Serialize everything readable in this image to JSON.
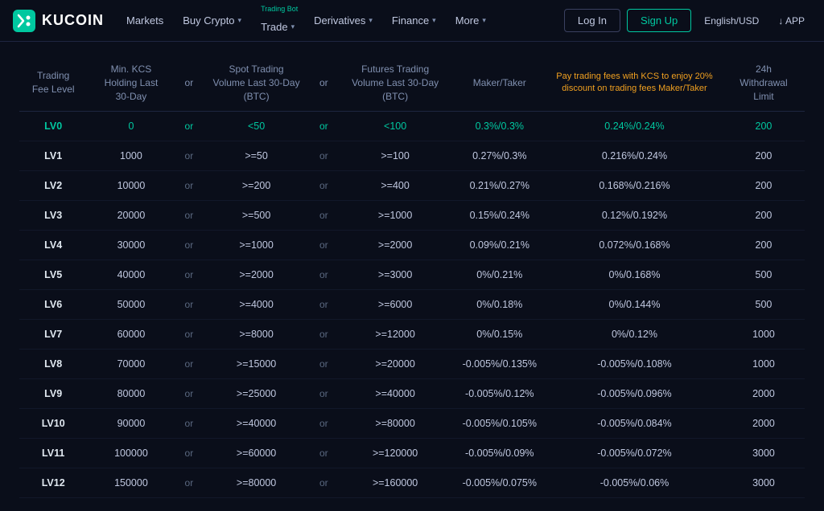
{
  "navbar": {
    "logo_text": "KUCOIN",
    "nav_items": [
      {
        "label": "Markets",
        "has_dropdown": false,
        "sub_label": null
      },
      {
        "label": "Buy Crypto",
        "has_dropdown": true,
        "sub_label": null
      },
      {
        "label": "Trade",
        "has_dropdown": true,
        "sub_label": "Trading Bot"
      },
      {
        "label": "Derivatives",
        "has_dropdown": true,
        "sub_label": null
      },
      {
        "label": "Finance",
        "has_dropdown": true,
        "sub_label": null
      },
      {
        "label": "More",
        "has_dropdown": true,
        "sub_label": null
      }
    ],
    "login_label": "Log In",
    "signup_label": "Sign Up",
    "lang_label": "English/USD",
    "app_label": "↓ APP"
  },
  "table": {
    "headers": [
      {
        "key": "level",
        "label": "Trading Fee Level"
      },
      {
        "key": "kcs",
        "label": "Min. KCS Holding Last 30-Day"
      },
      {
        "key": "or1",
        "label": "or"
      },
      {
        "key": "spot",
        "label": "Spot Trading Volume Last 30-Day (BTC)"
      },
      {
        "key": "or2",
        "label": "or"
      },
      {
        "key": "futures",
        "label": "Futures Trading Volume Last 30-Day (BTC)"
      },
      {
        "key": "maker_taker",
        "label": "Maker/Taker"
      },
      {
        "key": "kcs_discount",
        "label": "Pay trading fees with KCS to enjoy 20% discount on trading fees Maker/Taker",
        "highlight": true
      },
      {
        "key": "withdrawal",
        "label": "24h Withdrawal Limit"
      }
    ],
    "rows": [
      {
        "level": "LV0",
        "kcs": "0",
        "spot": "<50",
        "futures": "<100",
        "maker_taker": "0.3%/0.3%",
        "kcs_discount": "0.24%/0.24%",
        "withdrawal": "200",
        "highlighted": true
      },
      {
        "level": "LV1",
        "kcs": "1000",
        "spot": ">=50",
        "futures": ">=100",
        "maker_taker": "0.27%/0.3%",
        "kcs_discount": "0.216%/0.24%",
        "withdrawal": "200",
        "highlighted": false
      },
      {
        "level": "LV2",
        "kcs": "10000",
        "spot": ">=200",
        "futures": ">=400",
        "maker_taker": "0.21%/0.27%",
        "kcs_discount": "0.168%/0.216%",
        "withdrawal": "200",
        "highlighted": false
      },
      {
        "level": "LV3",
        "kcs": "20000",
        "spot": ">=500",
        "futures": ">=1000",
        "maker_taker": "0.15%/0.24%",
        "kcs_discount": "0.12%/0.192%",
        "withdrawal": "200",
        "highlighted": false
      },
      {
        "level": "LV4",
        "kcs": "30000",
        "spot": ">=1000",
        "futures": ">=2000",
        "maker_taker": "0.09%/0.21%",
        "kcs_discount": "0.072%/0.168%",
        "withdrawal": "200",
        "highlighted": false
      },
      {
        "level": "LV5",
        "kcs": "40000",
        "spot": ">=2000",
        "futures": ">=3000",
        "maker_taker": "0%/0.21%",
        "kcs_discount": "0%/0.168%",
        "withdrawal": "500",
        "highlighted": false
      },
      {
        "level": "LV6",
        "kcs": "50000",
        "spot": ">=4000",
        "futures": ">=6000",
        "maker_taker": "0%/0.18%",
        "kcs_discount": "0%/0.144%",
        "withdrawal": "500",
        "highlighted": false
      },
      {
        "level": "LV7",
        "kcs": "60000",
        "spot": ">=8000",
        "futures": ">=12000",
        "maker_taker": "0%/0.15%",
        "kcs_discount": "0%/0.12%",
        "withdrawal": "1000",
        "highlighted": false
      },
      {
        "level": "LV8",
        "kcs": "70000",
        "spot": ">=15000",
        "futures": ">=20000",
        "maker_taker": "-0.005%/0.135%",
        "kcs_discount": "-0.005%/0.108%",
        "withdrawal": "1000",
        "highlighted": false
      },
      {
        "level": "LV9",
        "kcs": "80000",
        "spot": ">=25000",
        "futures": ">=40000",
        "maker_taker": "-0.005%/0.12%",
        "kcs_discount": "-0.005%/0.096%",
        "withdrawal": "2000",
        "highlighted": false
      },
      {
        "level": "LV10",
        "kcs": "90000",
        "spot": ">=40000",
        "futures": ">=80000",
        "maker_taker": "-0.005%/0.105%",
        "kcs_discount": "-0.005%/0.084%",
        "withdrawal": "2000",
        "highlighted": false
      },
      {
        "level": "LV11",
        "kcs": "100000",
        "spot": ">=60000",
        "futures": ">=120000",
        "maker_taker": "-0.005%/0.09%",
        "kcs_discount": "-0.005%/0.072%",
        "withdrawal": "3000",
        "highlighted": false
      },
      {
        "level": "LV12",
        "kcs": "150000",
        "spot": ">=80000",
        "futures": ">=160000",
        "maker_taker": "-0.005%/0.075%",
        "kcs_discount": "-0.005%/0.06%",
        "withdrawal": "3000",
        "highlighted": false
      }
    ]
  }
}
